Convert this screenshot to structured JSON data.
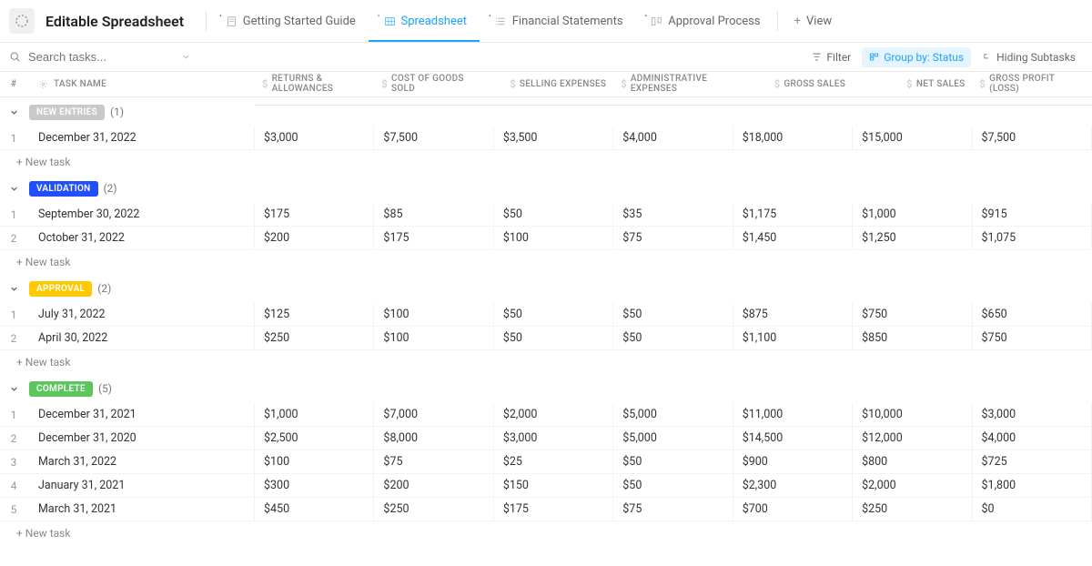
{
  "header": {
    "title": "Editable Spreadsheet"
  },
  "tabs": [
    {
      "label": "Getting Started Guide",
      "active": false
    },
    {
      "label": "Spreadsheet",
      "active": true
    },
    {
      "label": "Financial Statements",
      "active": false
    },
    {
      "label": "Approval Process",
      "active": false
    },
    {
      "label": "View",
      "active": false,
      "isAdd": true
    }
  ],
  "search": {
    "placeholder": "Search tasks..."
  },
  "toolbarButtons": {
    "filter": "Filter",
    "groupBy": "Group by: Status",
    "hiding": "Hiding Subtasks"
  },
  "columns": {
    "num": "#",
    "name": "TASK NAME",
    "c1": "RETURNS & ALLOWANCES",
    "c2": "COST OF GOODS SOLD",
    "c3": "SELLING EXPENSES",
    "c4": "ADMINISTRATIVE EXPENSES",
    "c5": "GROSS SALES",
    "c6": "NET SALES",
    "c7": "GROSS PROFIT (LOSS)"
  },
  "newTaskLabel": "+ New task",
  "groups": [
    {
      "label": "NEW ENTRIES",
      "color": "#c9c9c9",
      "count": "(1)",
      "rows": [
        {
          "num": "1",
          "name": "December 31, 2022",
          "c1": "$3,000",
          "c2": "$7,500",
          "c3": "$3,500",
          "c4": "$4,000",
          "c5": "$18,000",
          "c6": "$15,000",
          "c7": "$7,500"
        }
      ]
    },
    {
      "label": "VALIDATION",
      "color": "#1f4fff",
      "count": "(2)",
      "rows": [
        {
          "num": "1",
          "name": "September 30, 2022",
          "c1": "$175",
          "c2": "$85",
          "c3": "$50",
          "c4": "$35",
          "c5": "$1,175",
          "c6": "$1,000",
          "c7": "$915"
        },
        {
          "num": "2",
          "name": "October 31, 2022",
          "c1": "$200",
          "c2": "$175",
          "c3": "$100",
          "c4": "$75",
          "c5": "$1,450",
          "c6": "$1,250",
          "c7": "$1,075"
        }
      ]
    },
    {
      "label": "APPROVAL",
      "color": "#ffc900",
      "count": "(2)",
      "rows": [
        {
          "num": "1",
          "name": "July 31, 2022",
          "c1": "$125",
          "c2": "$100",
          "c3": "$50",
          "c4": "$50",
          "c5": "$875",
          "c6": "$750",
          "c7": "$650"
        },
        {
          "num": "2",
          "name": "April 30, 2022",
          "c1": "$250",
          "c2": "$100",
          "c3": "$50",
          "c4": "$50",
          "c5": "$1,100",
          "c6": "$850",
          "c7": "$750"
        }
      ]
    },
    {
      "label": "COMPLETE",
      "color": "#5bc65b",
      "count": "(5)",
      "rows": [
        {
          "num": "1",
          "name": "December 31, 2021",
          "c1": "$1,000",
          "c2": "$7,000",
          "c3": "$2,000",
          "c4": "$5,000",
          "c5": "$11,000",
          "c6": "$10,000",
          "c7": "$3,000"
        },
        {
          "num": "2",
          "name": "December 31, 2020",
          "c1": "$2,500",
          "c2": "$8,000",
          "c3": "$3,000",
          "c4": "$5,000",
          "c5": "$14,500",
          "c6": "$12,000",
          "c7": "$4,000"
        },
        {
          "num": "3",
          "name": "March 31, 2022",
          "c1": "$100",
          "c2": "$75",
          "c3": "$25",
          "c4": "$50",
          "c5": "$900",
          "c6": "$800",
          "c7": "$725"
        },
        {
          "num": "4",
          "name": "January 31, 2021",
          "c1": "$300",
          "c2": "$200",
          "c3": "$150",
          "c4": "$50",
          "c5": "$2,300",
          "c6": "$2,000",
          "c7": "$1,800"
        },
        {
          "num": "5",
          "name": "March 31, 2021",
          "c1": "$450",
          "c2": "$250",
          "c3": "$175",
          "c4": "$75",
          "c5": "$700",
          "c6": "$250",
          "c7": "$0"
        }
      ]
    }
  ]
}
